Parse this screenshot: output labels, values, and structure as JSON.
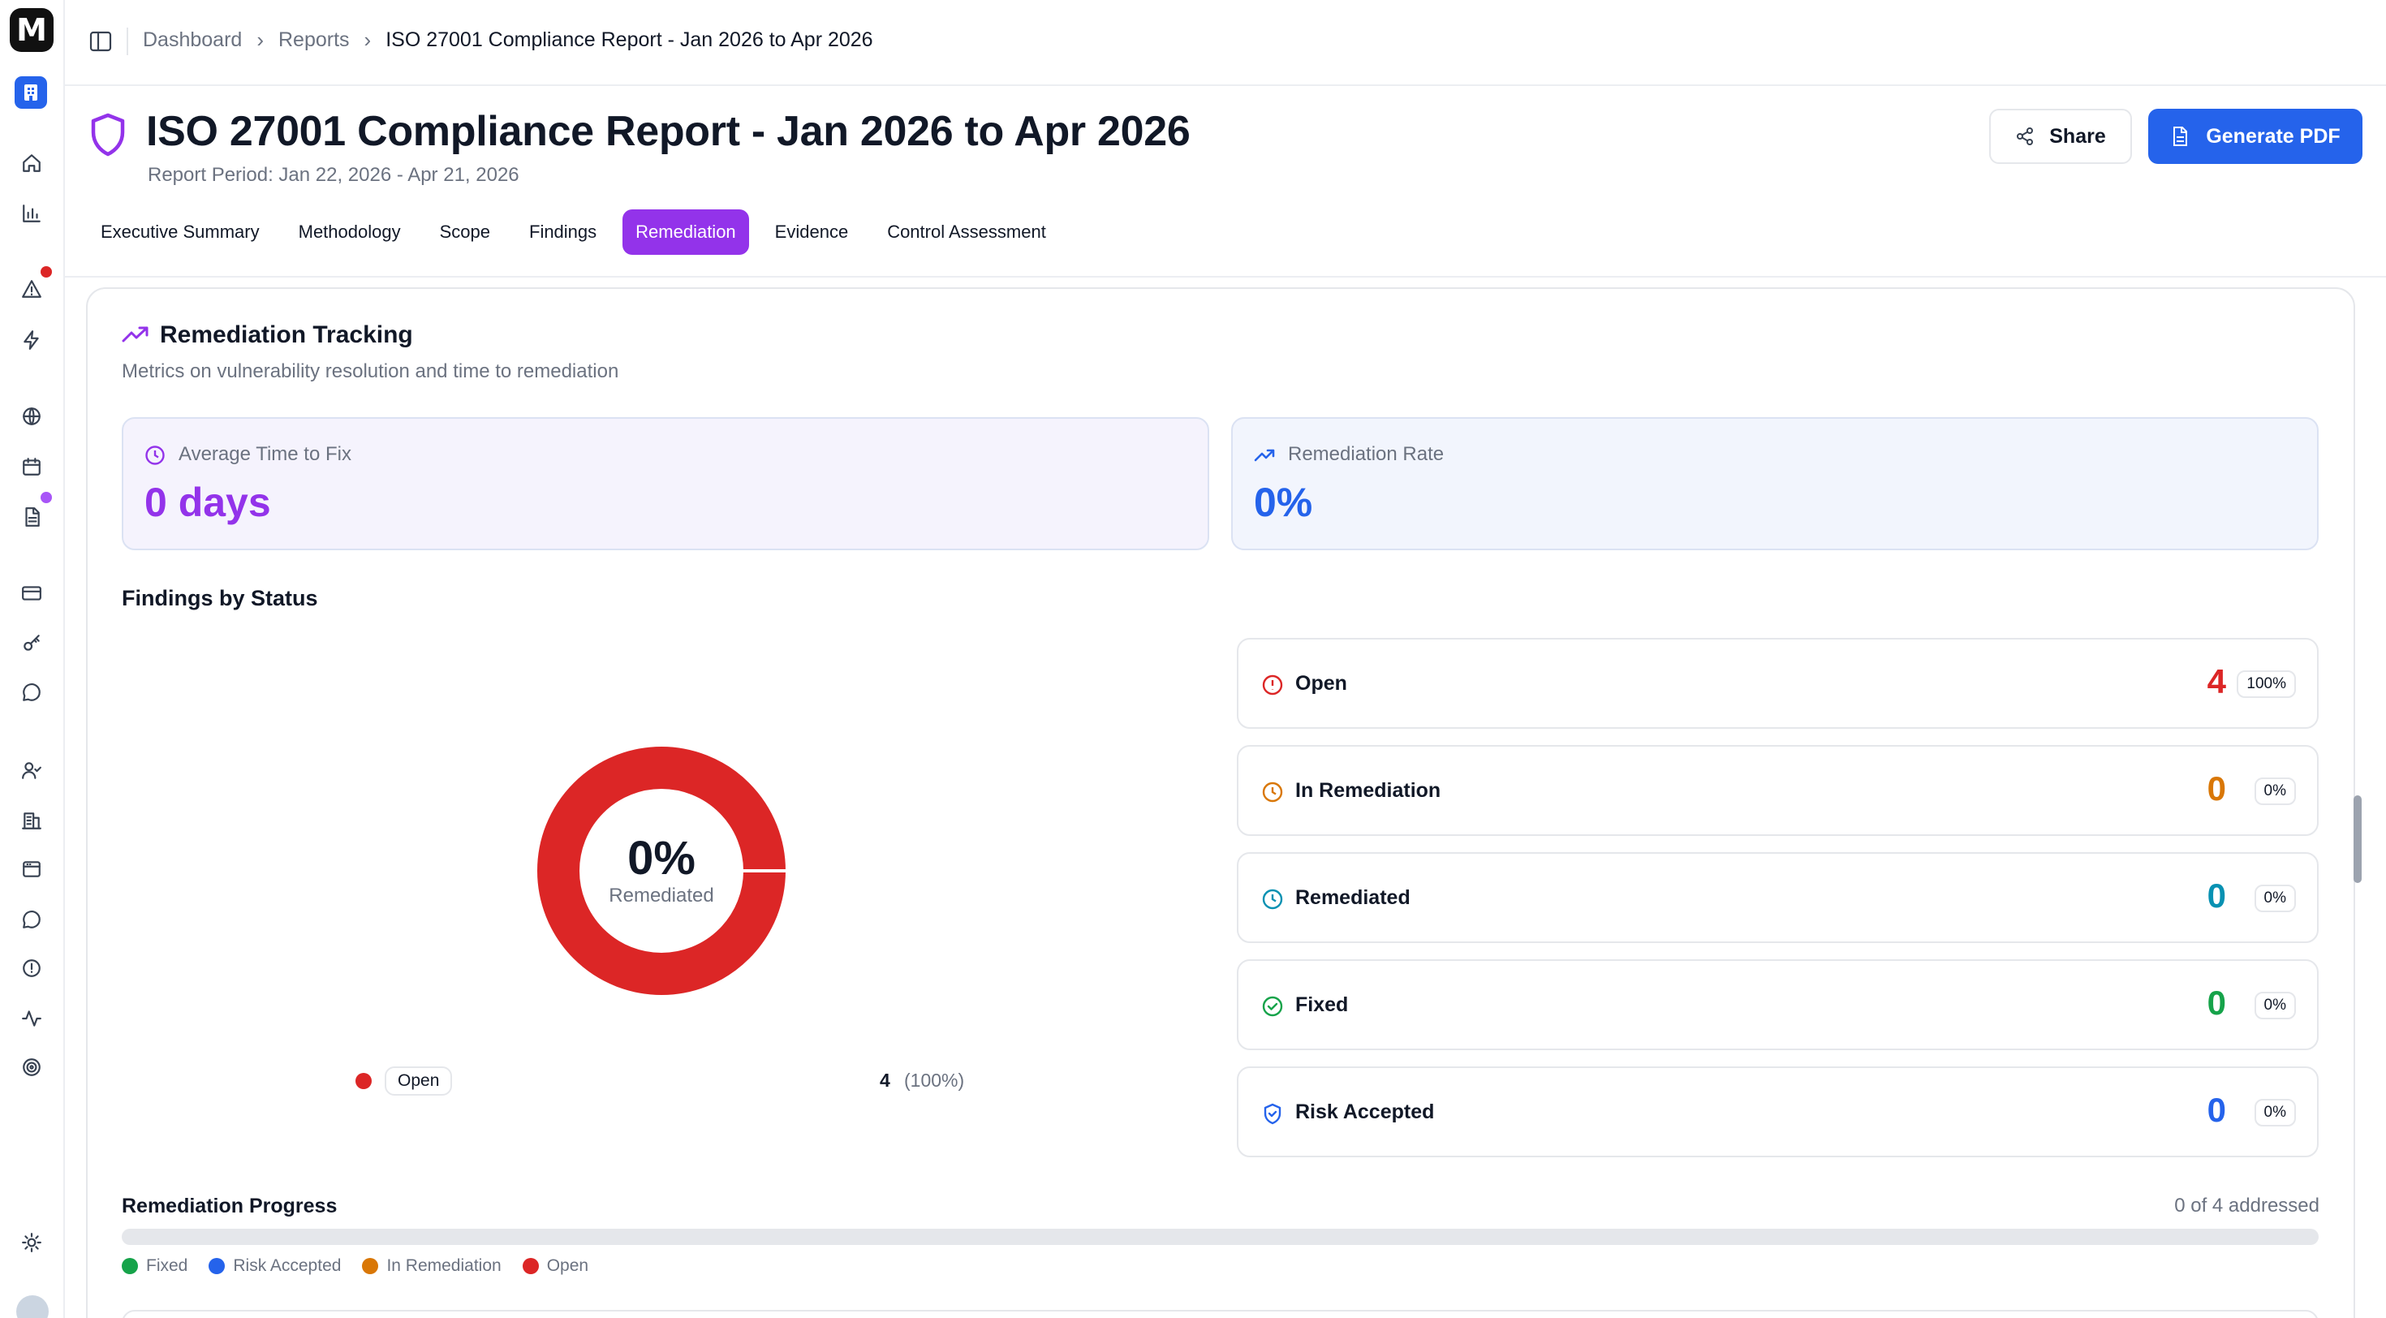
{
  "breadcrumb": {
    "items": [
      "Dashboard",
      "Reports"
    ],
    "current": "ISO 27001 Compliance Report - Jan 2026 to Apr 2026"
  },
  "header": {
    "title": "ISO 27001 Compliance Report - Jan 2026 to Apr 2026",
    "subtitle": "Report Period: Jan 22, 2026 - Apr 21, 2026",
    "share_label": "Share",
    "generate_label": "Generate PDF"
  },
  "tabs": [
    {
      "label": "Executive Summary",
      "active": false
    },
    {
      "label": "Methodology",
      "active": false
    },
    {
      "label": "Scope",
      "active": false
    },
    {
      "label": "Findings",
      "active": false
    },
    {
      "label": "Remediation",
      "active": true
    },
    {
      "label": "Evidence",
      "active": false
    },
    {
      "label": "Control Assessment",
      "active": false
    }
  ],
  "section": {
    "title": "Remediation Tracking",
    "subtitle": "Metrics on vulnerability resolution and time to remediation"
  },
  "metrics": {
    "avg_time": {
      "label": "Average Time to Fix",
      "value": "0 days"
    },
    "rate": {
      "label": "Remediation Rate",
      "value": "0%"
    }
  },
  "findings_by_status": {
    "title": "Findings by Status",
    "donut": {
      "percent": "0%",
      "label": "Remediated"
    },
    "legend": {
      "label": "Open",
      "count": "4",
      "percent": "(100%)"
    },
    "rows": [
      {
        "name": "Open",
        "count": "4",
        "percent": "100%",
        "color": "#dc2626",
        "icon": "alert-circle-icon"
      },
      {
        "name": "In Remediation",
        "count": "0",
        "percent": "0%",
        "color": "#d97706",
        "icon": "clock-icon"
      },
      {
        "name": "Remediated",
        "count": "0",
        "percent": "0%",
        "color": "#0891b2",
        "icon": "clock-icon"
      },
      {
        "name": "Fixed",
        "count": "0",
        "percent": "0%",
        "color": "#16a34a",
        "icon": "check-circle-icon"
      },
      {
        "name": "Risk Accepted",
        "count": "0",
        "percent": "0%",
        "color": "#2563eb",
        "icon": "shield-check-icon"
      }
    ]
  },
  "progress": {
    "title": "Remediation Progress",
    "summary": "0 of 4 addressed",
    "filled_fraction": 0,
    "legend": [
      {
        "label": "Fixed",
        "color": "#16a34a"
      },
      {
        "label": "Risk Accepted",
        "color": "#2563eb"
      },
      {
        "label": "In Remediation",
        "color": "#d97706"
      },
      {
        "label": "Open",
        "color": "#dc2626"
      }
    ]
  },
  "colors": {
    "accent": "#9333ea",
    "primary": "#2563eb",
    "open": "#dc2626"
  }
}
